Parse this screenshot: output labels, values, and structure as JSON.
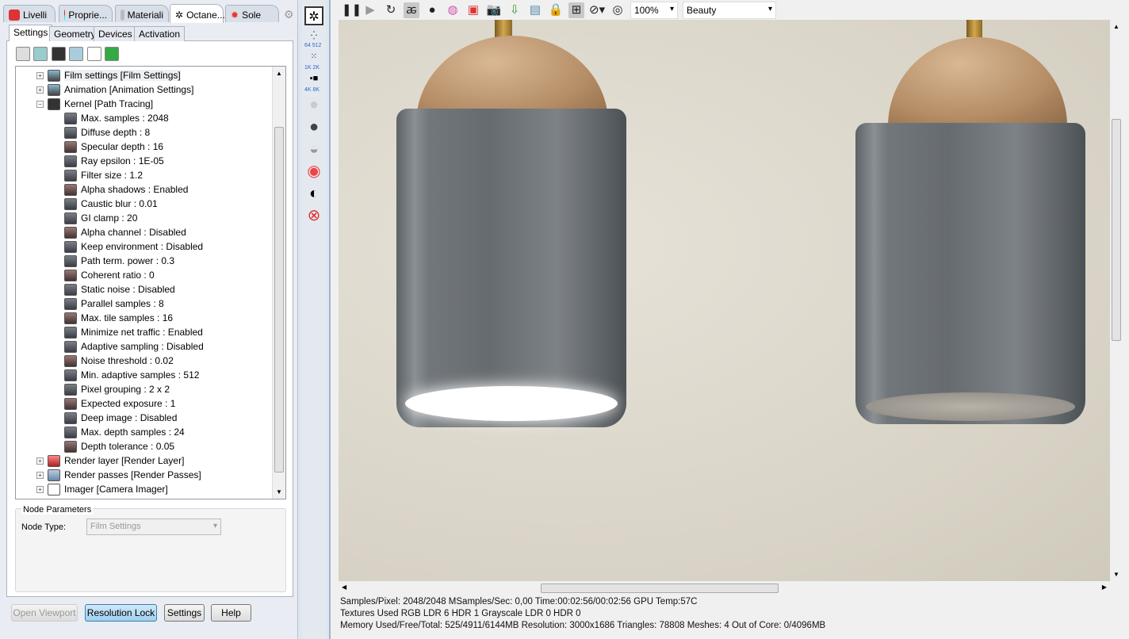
{
  "panel_tabs": [
    {
      "label": "Livelli",
      "icon": "layers-icon"
    },
    {
      "label": "Proprie...",
      "icon": "properties-icon"
    },
    {
      "label": "Materiali",
      "icon": "materials-icon"
    },
    {
      "label": "Octane...",
      "icon": "octane-icon"
    },
    {
      "label": "Sole",
      "icon": "sun-icon"
    }
  ],
  "settings_tabs": [
    "Settings",
    "Geometry",
    "Devices",
    "Activation"
  ],
  "tree": {
    "top": [
      {
        "label": "Film settings  [Film Settings]",
        "selected": true
      },
      {
        "label": "Animation  [Animation Settings]"
      },
      {
        "label": "Kernel  [Path Tracing]",
        "expanded": true
      }
    ],
    "kernel_items": [
      "Max. samples : 2048",
      "Diffuse depth : 8",
      "Specular depth : 16",
      "Ray epsilon : 1E-05",
      "Filter size : 1.2",
      "Alpha shadows : Enabled",
      "Caustic blur : 0.01",
      "GI clamp : 20",
      "Alpha channel : Disabled",
      "Keep environment : Disabled",
      "Path term. power : 0.3",
      "Coherent ratio : 0",
      "Static noise : Disabled",
      "Parallel samples : 8",
      "Max. tile samples : 16",
      "Minimize net traffic : Enabled",
      "Adaptive sampling : Disabled",
      "Noise threshold : 0.02",
      "Min. adaptive samples : 512",
      "Pixel grouping : 2 x 2",
      "Expected exposure : 1",
      "Deep image : Disabled",
      "Max. depth samples : 24",
      "Depth tolerance : 0.05"
    ],
    "bottom": [
      "Render layer  [Render Layer]",
      "Render passes  [Render Passes]",
      "Imager  [Camera Imager]"
    ]
  },
  "node_params": {
    "title": "Node Parameters",
    "type_label": "Node Type:",
    "type_value": "Film Settings"
  },
  "buttons": {
    "open_viewport": "Open Viewport",
    "resolution_lock": "Resolution Lock",
    "settings": "Settings",
    "help": "Help"
  },
  "strip_labels": [
    "64",
    "512",
    "1K",
    "2K",
    "4K",
    "8K"
  ],
  "toolbar": {
    "zoom": "100%",
    "pass": "Beauty"
  },
  "status": {
    "line1": "Samples/Pixel: 2048/2048  MSamples/Sec: 0,00  Time:00:02:56/00:02:56  GPU Temp:57C",
    "line2": "Textures Used RGB LDR 6  HDR 1  Grayscale LDR 0  HDR 0",
    "line3": "Memory Used/Free/Total: 525/4911/6144MB  Resolution: 3000x1686  Triangles: 78808  Meshes: 4 Out of Core: 0/4096MB"
  }
}
